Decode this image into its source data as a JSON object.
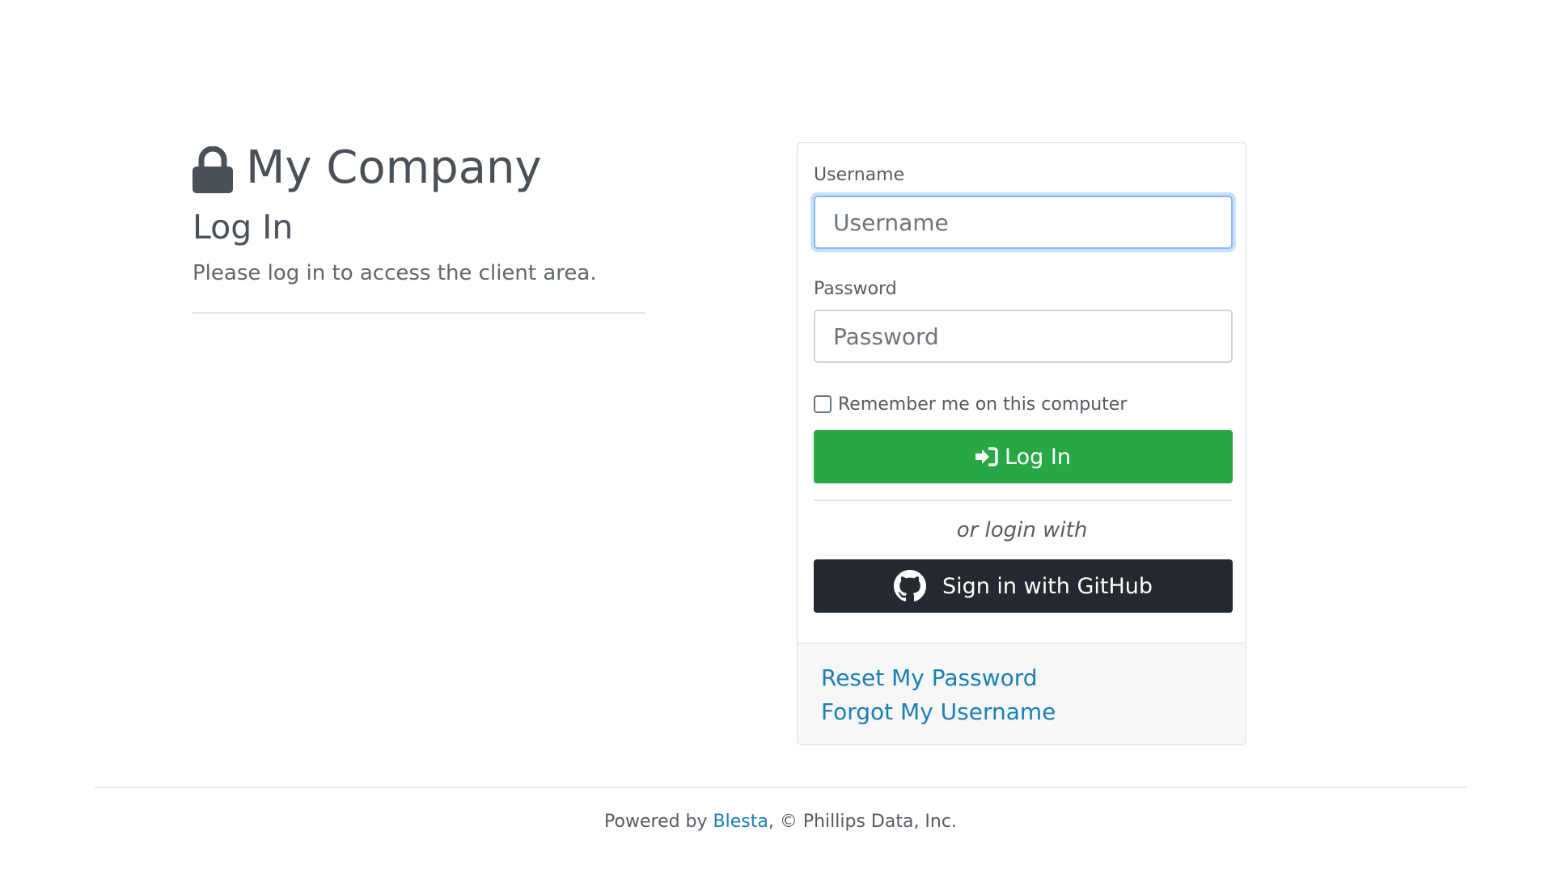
{
  "brand": {
    "name": "My Company",
    "icon": "lock-icon"
  },
  "login": {
    "heading": "Log In",
    "description": "Please log in to access the client area."
  },
  "form": {
    "username": {
      "label": "Username",
      "placeholder": "Username",
      "value": ""
    },
    "password": {
      "label": "Password",
      "placeholder": "Password",
      "value": ""
    },
    "remember": {
      "label": "Remember me on this computer",
      "checked": false
    },
    "login_button": {
      "label": "Log In",
      "icon": "sign-in-icon",
      "color": "#28a745"
    },
    "or_login_with": "or login with",
    "github_button": {
      "label": "Sign in with GitHub",
      "icon": "github-icon",
      "color": "#24292f"
    }
  },
  "card_footer": {
    "reset_password": "Reset My Password",
    "forgot_username": "Forgot My Username"
  },
  "footer": {
    "prefix": "Powered by ",
    "link": "Blesta",
    "suffix": ", © Phillips Data, Inc."
  },
  "colors": {
    "link": "#1a7fb5",
    "text": "#495057"
  }
}
